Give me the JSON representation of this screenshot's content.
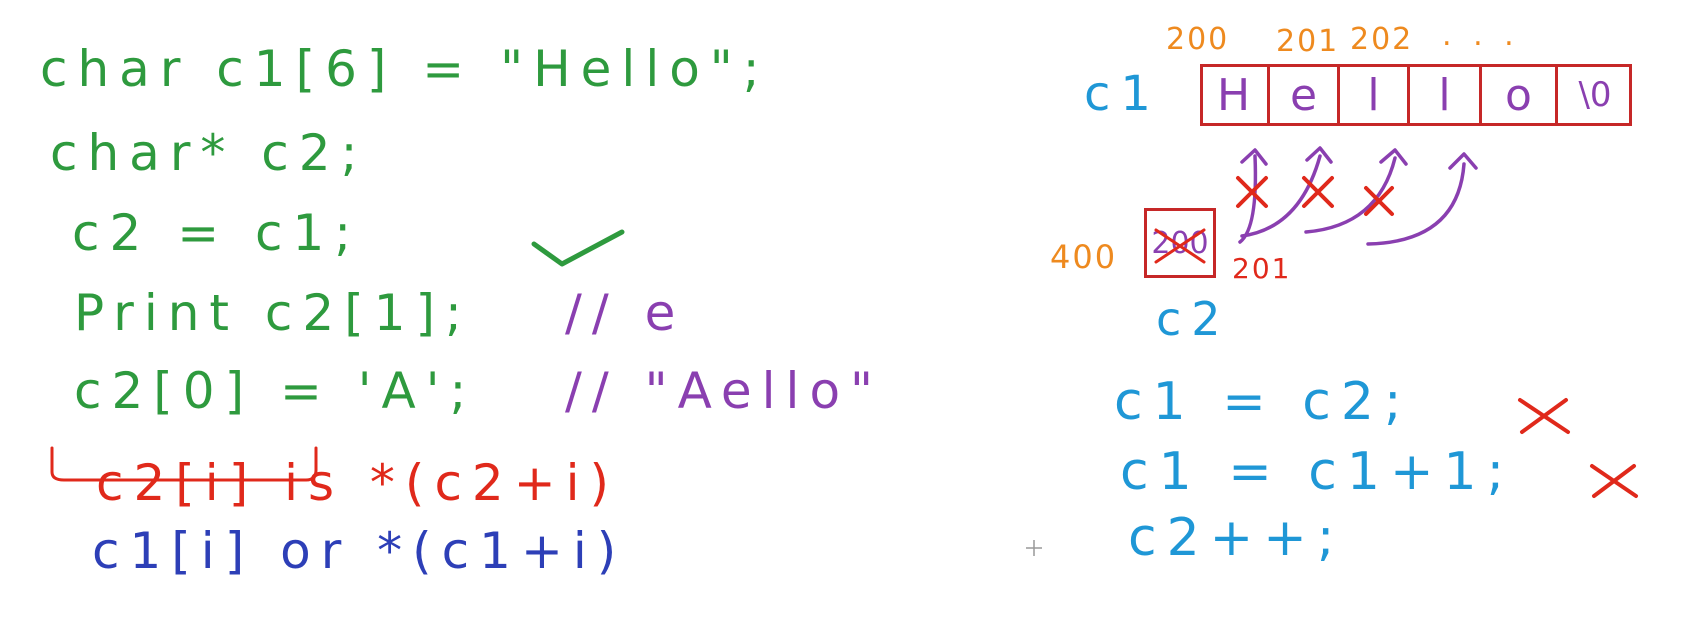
{
  "code": {
    "line1": "char c1[6] = \"Hello\";",
    "line2": "char* c2;",
    "line3": "c2 = c1;",
    "line4": "Print c2[1];",
    "line4_comment": "// e",
    "line5": "c2[0] = 'A';",
    "line5_comment": "// \"Aello\"",
    "note1": "c2[i] is *(c2+i)",
    "note2": "c1[i] or *(c1+i)"
  },
  "diagram": {
    "array_label": "c1",
    "addresses": [
      "200",
      "201",
      "202"
    ],
    "ellipsis": ". . .",
    "cells": [
      "H",
      "e",
      "l",
      "l",
      "o",
      "\\0"
    ],
    "pointer_label": "c2",
    "pointer_address": "400",
    "pointer_value_old": "200",
    "pointer_value_new": "201"
  },
  "rules": {
    "rule1": "c1 = c2;",
    "rule2": "c1 = c1+1;",
    "rule3": "c2++;"
  },
  "colors": {
    "code": "#2e9a3e",
    "comment": "#8a3fb0",
    "note1": "#e0291b",
    "note2": "#2d3fb7",
    "diagram_label": "#1f97d6",
    "address": "#ee8a1f",
    "box": "#c62828"
  }
}
